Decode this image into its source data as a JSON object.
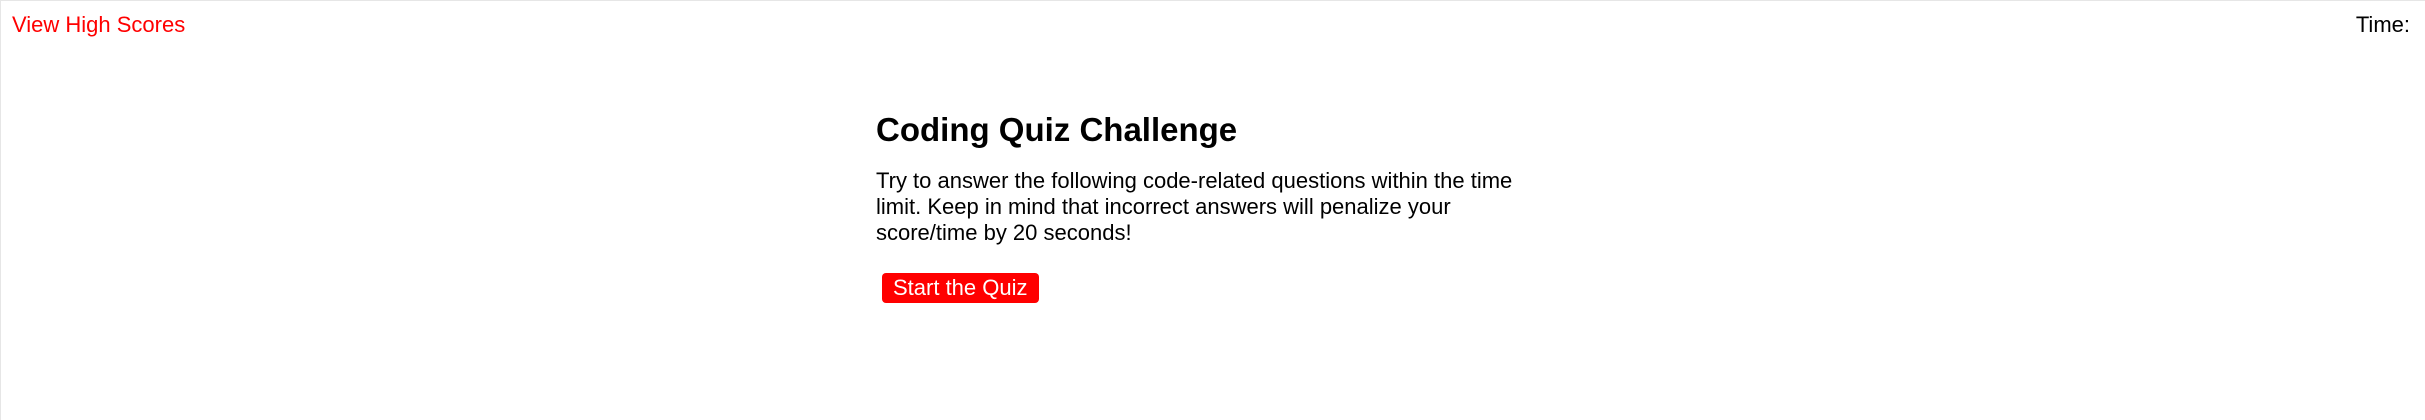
{
  "header": {
    "high_scores_link": "View High Scores",
    "timer_label": "Time:",
    "timer_value": ""
  },
  "main": {
    "title": "Coding Quiz Challenge",
    "description": "Try to answer the following code-related questions within the time limit. Keep in mind that incorrect answers will penalize your score/time by 20 seconds!",
    "start_button_label": "Start the Quiz"
  },
  "colors": {
    "accent": "#ff0000",
    "text": "#000000",
    "background": "#ffffff",
    "button_text": "#ffffff"
  }
}
